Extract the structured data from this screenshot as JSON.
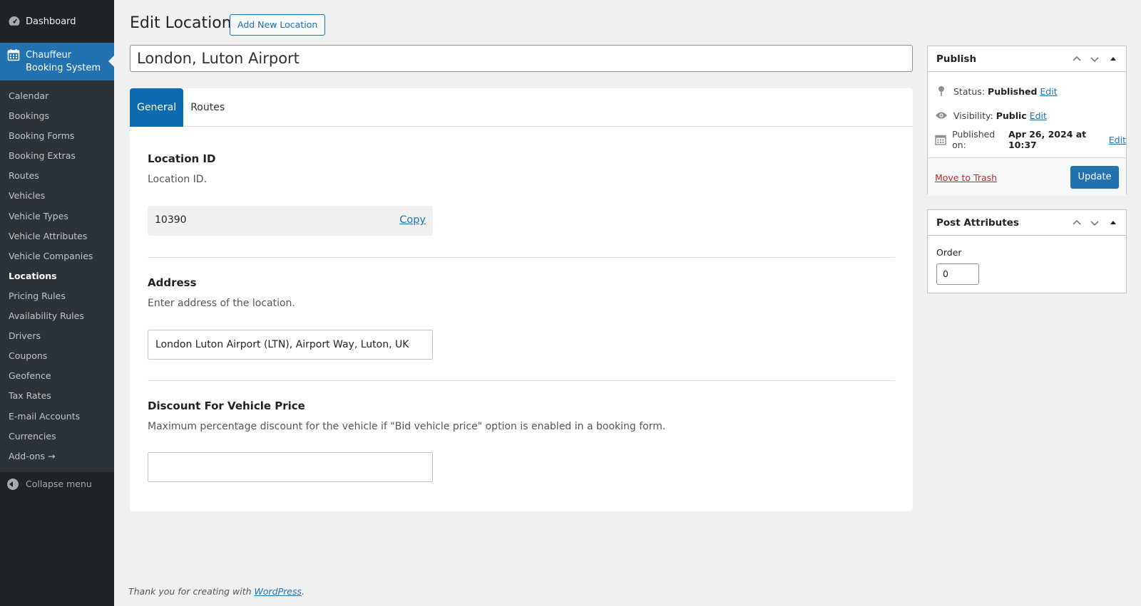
{
  "sidebar": {
    "dashboard_label": "Dashboard",
    "plugin_label_line1": "Chauffeur",
    "plugin_label_line2": "Booking System",
    "items": [
      {
        "label": "Calendar"
      },
      {
        "label": "Bookings"
      },
      {
        "label": "Booking Forms"
      },
      {
        "label": "Booking Extras"
      },
      {
        "label": "Routes"
      },
      {
        "label": "Vehicles"
      },
      {
        "label": "Vehicle Types"
      },
      {
        "label": "Vehicle Attributes"
      },
      {
        "label": "Vehicle Companies"
      },
      {
        "label": "Locations",
        "current": true
      },
      {
        "label": "Pricing Rules"
      },
      {
        "label": "Availability Rules"
      },
      {
        "label": "Drivers"
      },
      {
        "label": "Coupons"
      },
      {
        "label": "Geofence"
      },
      {
        "label": "Tax Rates"
      },
      {
        "label": "E-mail Accounts"
      },
      {
        "label": "Currencies"
      },
      {
        "label": "Add-ons →"
      }
    ],
    "collapse_label": "Collapse menu"
  },
  "header": {
    "title": "Edit Location",
    "add_new_label": "Add New Location"
  },
  "post_title": "London, Luton Airport",
  "tabs": [
    {
      "label": "General",
      "active": true
    },
    {
      "label": "Routes",
      "active": false
    }
  ],
  "general": {
    "location_id": {
      "title": "Location ID",
      "description": "Location ID.",
      "value": "10390",
      "copy_label": "Copy"
    },
    "address": {
      "title": "Address",
      "description": "Enter address of the location.",
      "value": "London Luton Airport (LTN), Airport Way, Luton, UK"
    },
    "discount": {
      "title": "Discount For Vehicle Price",
      "description": "Maximum percentage discount for the vehicle if \"Bid vehicle price\" option is enabled in a booking form.",
      "value": ""
    }
  },
  "publish": {
    "title": "Publish",
    "status_label": "Status:",
    "status_value": "Published",
    "visibility_label": "Visibility:",
    "visibility_value": "Public",
    "published_label": "Published on:",
    "published_value": "Apr 26, 2024 at 10:37",
    "edit_label": "Edit",
    "trash_label": "Move to Trash",
    "update_label": "Update"
  },
  "post_attributes": {
    "title": "Post Attributes",
    "order_label": "Order",
    "order_value": "0"
  },
  "footer": {
    "text": "Thank you for creating with ",
    "link": "WordPress",
    "suffix": "."
  },
  "colors": {
    "sidebar_bg": "#1d2327",
    "accent": "#2271b1",
    "tab_active": "#0c6bb0",
    "trash": "#b32d2e"
  },
  "icons": {
    "dashboard": "dashboard-icon",
    "plugin": "calendar-icon",
    "status": "pin-icon",
    "visibility": "eye-icon",
    "published": "calendar-icon",
    "collapse": "collapse-arrow-icon"
  }
}
